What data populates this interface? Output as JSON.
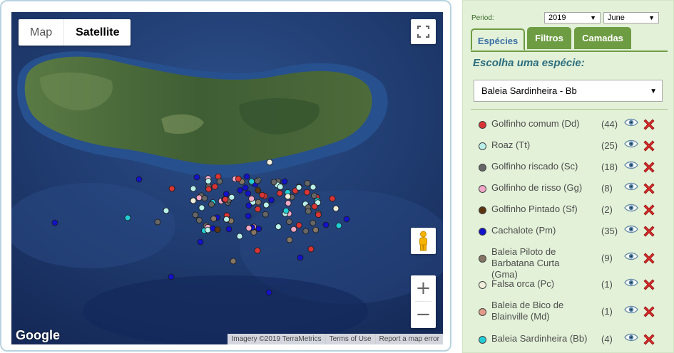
{
  "map": {
    "type_control": {
      "map": "Map",
      "satellite": "Satellite",
      "selected": "Satellite"
    },
    "icons": {
      "fullscreen": "fullscreen-icon",
      "pegman": "pegman-icon",
      "zoom_in": "+",
      "zoom_out": "−"
    },
    "logo": "Google",
    "attribution": [
      "Imagery ©2019 TerraMetrics",
      "Terms of Use",
      "Report a map error"
    ],
    "colors": {
      "ocean": "#1f3a70",
      "land": "#4e6d3f"
    }
  },
  "sidebar": {
    "period_label": "Period:",
    "year": "2019",
    "month": "June",
    "tabs": [
      {
        "label": "Espécies",
        "active": true
      },
      {
        "label": "Filtros",
        "active": false
      },
      {
        "label": "Camadas",
        "active": false
      }
    ],
    "choose_title": "Escolha uma espécie:",
    "selected_species": "Baleia Sardinheira - Bb",
    "species": [
      {
        "name": "Golfinho comum (Dd)",
        "count": "(44)",
        "color": "#d93535"
      },
      {
        "name": "Roaz (Tt)",
        "count": "(25)",
        "color": "#b9f0ea"
      },
      {
        "name": "Golfinho riscado (Sc)",
        "count": "(18)",
        "color": "#666666"
      },
      {
        "name": "Golfinho de risso (Gg)",
        "count": "(8)",
        "color": "#f0a8c8"
      },
      {
        "name": "Golfinho Pintado (Sf)",
        "count": "(2)",
        "color": "#5a3510"
      },
      {
        "name": "Cachalote (Pm)",
        "count": "(35)",
        "color": "#1212c8"
      },
      {
        "name": "Baleia Piloto de Barbatana Curta (Gma)",
        "count": "(9)",
        "color": "#857565"
      },
      {
        "name": "Falsa orca (Pc)",
        "count": "(1)",
        "color": "#f0eedc"
      },
      {
        "name": "Baleia de Bico de Blainville (Md)",
        "count": "(1)",
        "color": "#e29a8a"
      },
      {
        "name": "Baleia Sardinheira (Bb)",
        "count": "(4)",
        "color": "#22cdd6"
      }
    ],
    "row_icons": {
      "view": "eye-icon",
      "remove": "close-icon"
    }
  }
}
